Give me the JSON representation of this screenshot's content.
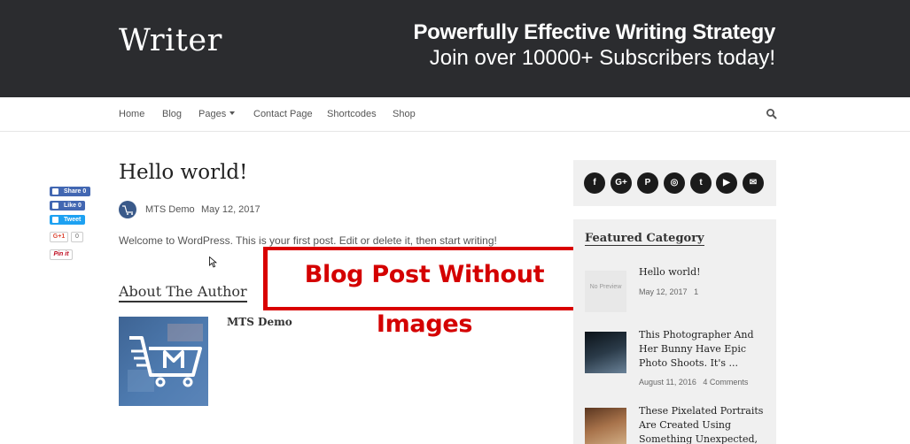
{
  "header": {
    "logo": "Writer",
    "promo_title": "Powerfully Effective Writing Strategy",
    "promo_subtitle": "Join over 10000+ Subscribers today!"
  },
  "nav": {
    "items": [
      "Home",
      "Blog",
      "Pages",
      "Contact Page",
      "Shortcodes",
      "Shop"
    ],
    "search_icon": "search-icon"
  },
  "share": {
    "facebook_share": "Share 0",
    "facebook_like": "Like 0",
    "twitter": "Tweet",
    "google_plus": "G+1",
    "google_count": "0",
    "pinterest": "Pin it"
  },
  "post": {
    "title": "Hello world!",
    "author": "MTS Demo",
    "date": "May 12, 2017",
    "excerpt": "Welcome to WordPress. This is your first post. Edit or delete it, then start writing!"
  },
  "about": {
    "heading": "About The Author",
    "author_name": "MTS Demo"
  },
  "overlay": {
    "text": "Blog Post Without Images"
  },
  "sidebar": {
    "social_icons": [
      "facebook-icon",
      "google-plus-icon",
      "pinterest-icon",
      "instagram-icon",
      "twitter-icon",
      "youtube-icon",
      "email-icon"
    ],
    "social_glyphs": [
      "f",
      "G+",
      "P",
      "◎",
      "t",
      "▶",
      "✉"
    ],
    "featured_heading": "Featured Category",
    "items": [
      {
        "thumb_text": "No Preview",
        "title_lines": [
          "Hello world!"
        ],
        "date": "May 12, 2017",
        "comments": "1"
      },
      {
        "title_lines": [
          "This Photographer And",
          "Her Bunny Have Epic",
          "Photo Shoots. It's ..."
        ],
        "date": "August 11, 2016",
        "comments": "4 Comments"
      },
      {
        "title_lines": [
          "These Pixelated Portraits",
          "Are Created Using",
          "Something Unexpected,"
        ]
      }
    ]
  },
  "colors": {
    "header_bg": "#2b2c2f",
    "overlay_red": "#d90000",
    "facebook": "#4267b2",
    "twitter": "#1da1f2"
  }
}
